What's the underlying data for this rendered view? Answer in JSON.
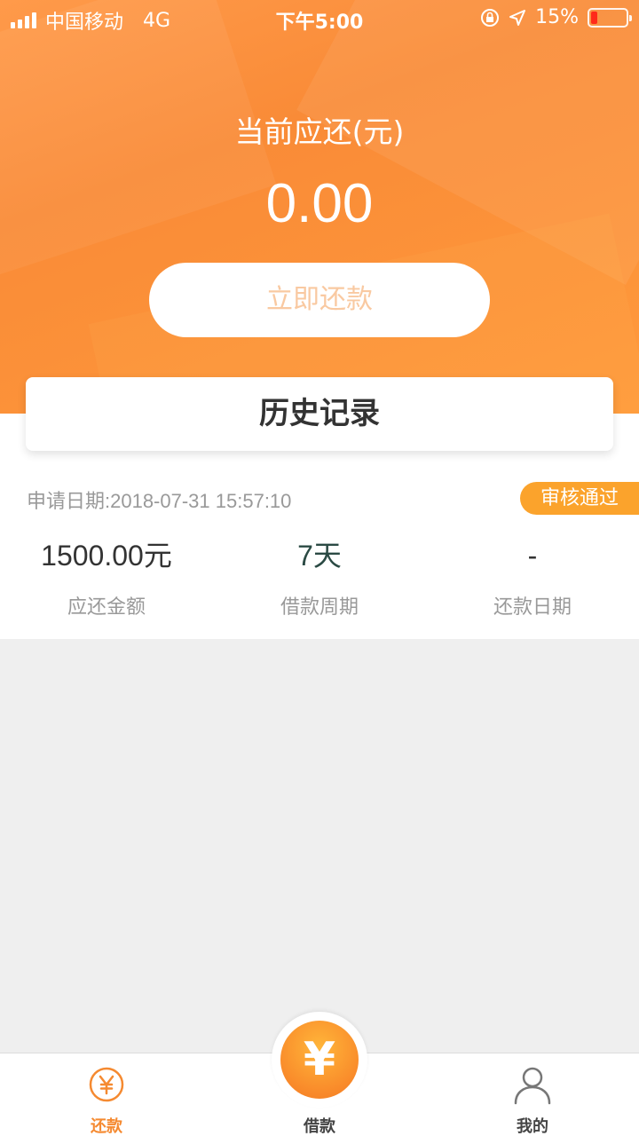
{
  "status_bar": {
    "carrier": "中国移动",
    "network": "4G",
    "time": "下午5:00",
    "battery": "15%"
  },
  "header": {
    "due_label": "当前应还(元)",
    "due_amount": "0.00",
    "pay_button": "立即还款",
    "accent_color": "#f98b37"
  },
  "history": {
    "title": "历史记录"
  },
  "record": {
    "apply_date": "申请日期:2018-07-31 15:57:10",
    "status": "审核通过",
    "stats": [
      {
        "value": "1500.00元",
        "label": "应还金额"
      },
      {
        "value": "7天",
        "label": "借款周期"
      },
      {
        "value": "-",
        "label": "还款日期"
      }
    ]
  },
  "tabbar": {
    "tabs": [
      {
        "label": "还款",
        "icon": "yen-circle-icon",
        "active": true
      },
      {
        "label": "借款",
        "icon": "yen-icon",
        "active": false
      },
      {
        "label": "我的",
        "icon": "user-icon",
        "active": false
      }
    ],
    "center_symbol": "¥"
  }
}
